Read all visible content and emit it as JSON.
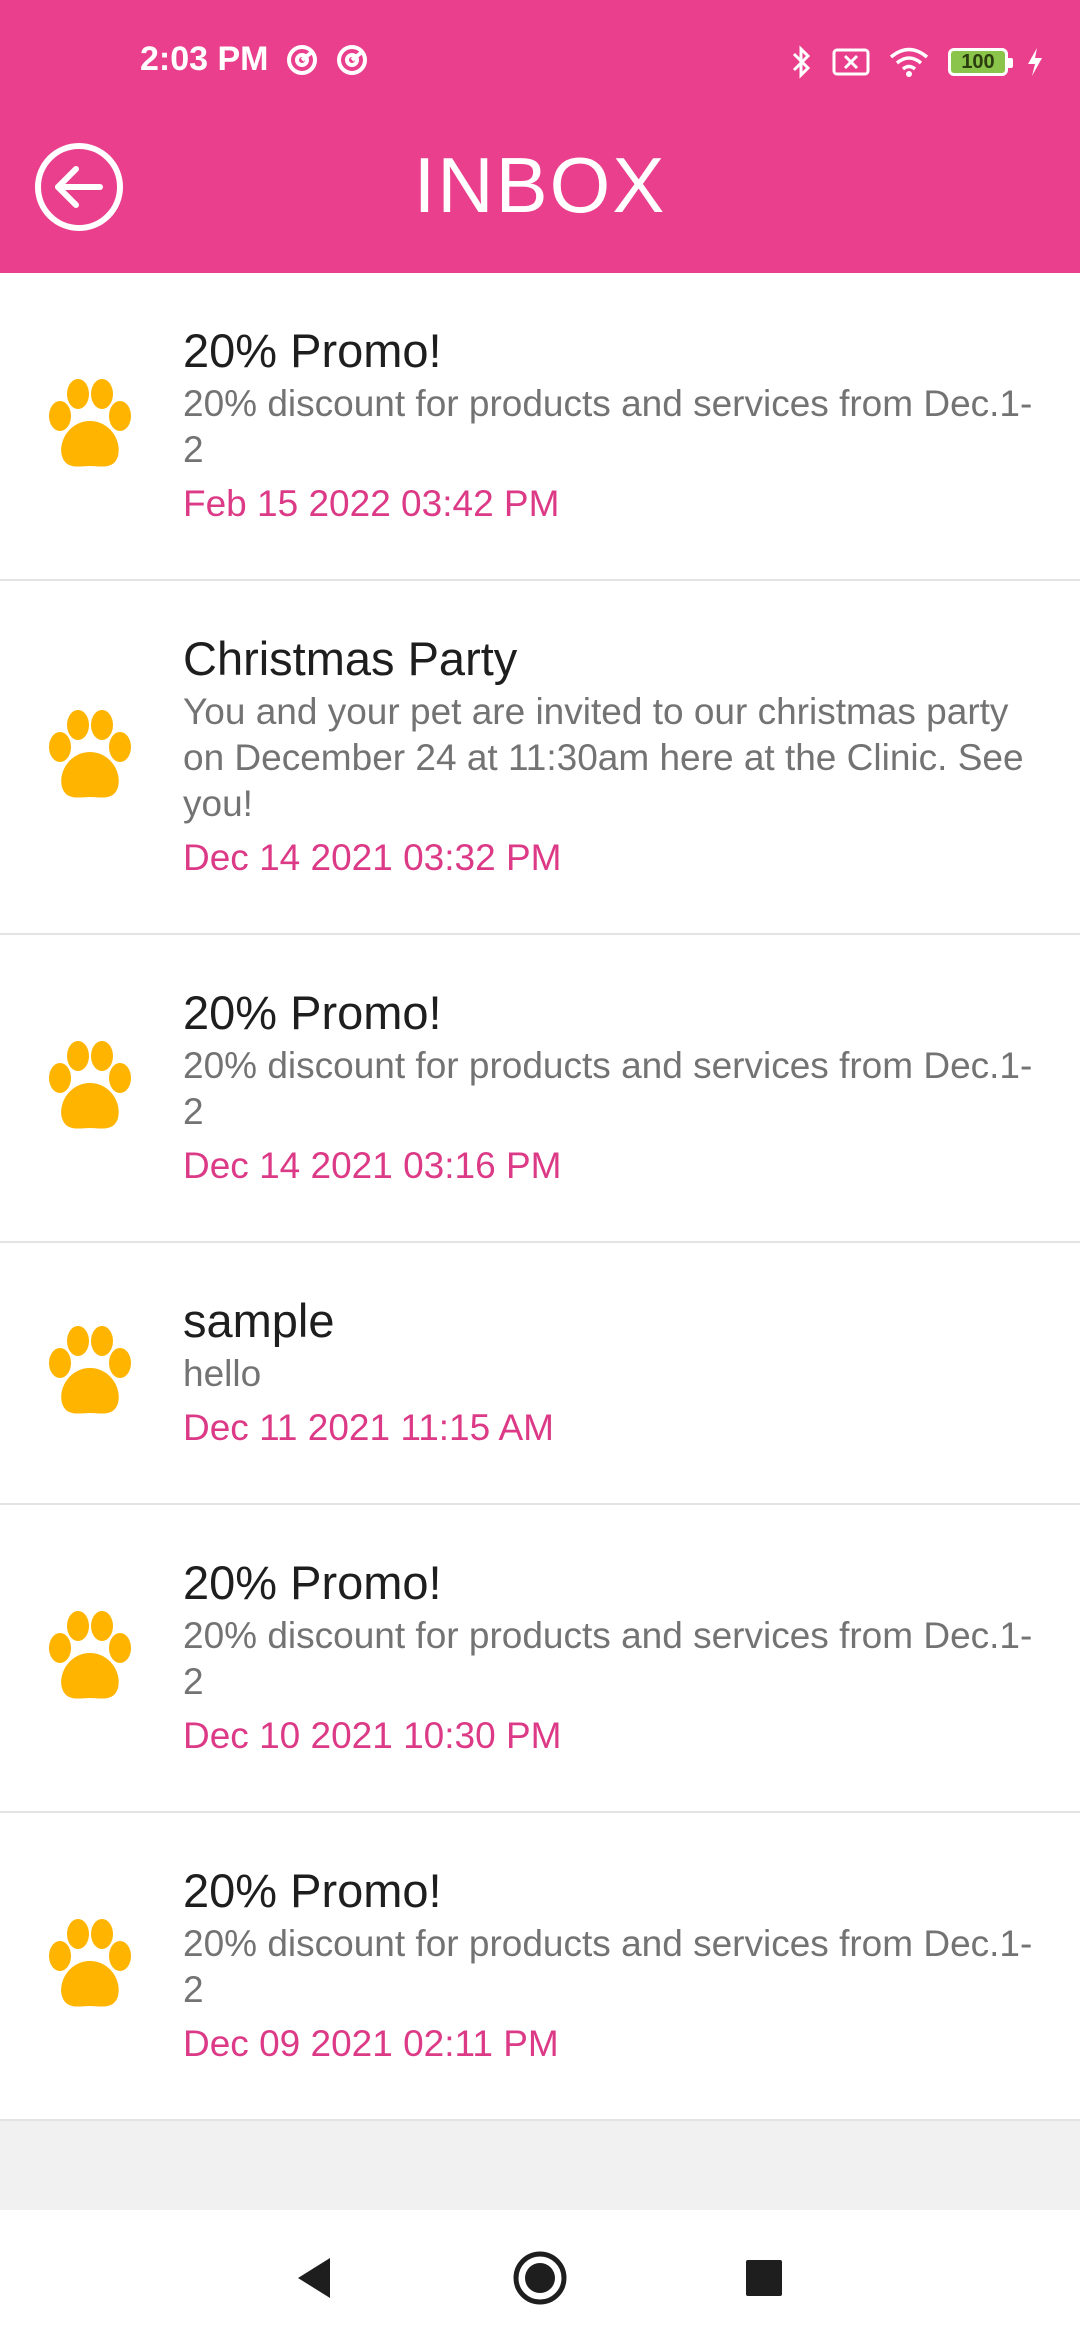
{
  "status": {
    "time": "2:03 PM",
    "battery": "100"
  },
  "header": {
    "title": "INBOX"
  },
  "colors": {
    "brand": "#ea3f8c",
    "date": "#dc3a87",
    "paw": "#ffb400"
  },
  "messages": [
    {
      "title": "20% Promo!",
      "body": "20% discount for products and services from Dec.1-2",
      "date": "Feb 15 2022 03:42 PM"
    },
    {
      "title": "Christmas Party",
      "body": "You and your pet are invited to our christmas party on December 24 at 11:30am here at the Clinic. See you!",
      "date": "Dec 14 2021 03:32 PM"
    },
    {
      "title": "20% Promo!",
      "body": "20% discount for products and services from Dec.1-2",
      "date": "Dec 14 2021 03:16 PM"
    },
    {
      "title": "sample",
      "body": "hello",
      "date": "Dec 11 2021 11:15 AM"
    },
    {
      "title": "20% Promo!",
      "body": "20% discount for products and services from Dec.1-2",
      "date": "Dec 10 2021 10:30 PM"
    },
    {
      "title": "20% Promo!",
      "body": "20% discount for products and services from Dec.1-2",
      "date": "Dec 09 2021 02:11 PM"
    }
  ]
}
